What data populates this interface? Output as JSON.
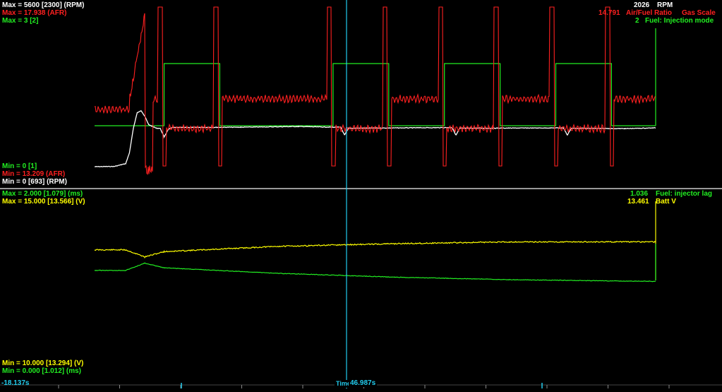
{
  "top_panel": {
    "labels_left_top": [
      {
        "text": "Max = 5600 [2300] (RPM)",
        "color": "#ffffff"
      },
      {
        "text": "Max = 17.938 (AFR)",
        "color": "#ff2020"
      },
      {
        "text": "Max = 3 [2]",
        "color": "#22ee22"
      }
    ],
    "labels_left_bottom": [
      {
        "text": "Min = 0 [1]",
        "color": "#22ee22"
      },
      {
        "text": "Min = 13.209 (AFR)",
        "color": "#ff2020"
      },
      {
        "text": "Min = 0 [693] (RPM)",
        "color": "#ffffff"
      }
    ],
    "readout_rpm": {
      "value": "2026",
      "unit": "RPM"
    },
    "readout_afr": {
      "value": "14.791",
      "name": "Air/Fuel Ratio",
      "extra": "Gas Scale"
    },
    "readout_injmode": {
      "value": "2",
      "name": "Fuel: Injection mode"
    }
  },
  "bottom_panel": {
    "labels_left_top": [
      {
        "text": "Max = 2.000 [1.079] (ms)",
        "color": "#22ee22"
      },
      {
        "text": "Max = 15.000 [13.566] (V)",
        "color": "#ffff00"
      }
    ],
    "labels_left_bottom": [
      {
        "text": "Min = 10.000 [13.294] (V)",
        "color": "#ffff00"
      },
      {
        "text": "Min = 0.000 [1.012] (ms)",
        "color": "#22ee22"
      }
    ],
    "readout_injlag": {
      "value": "1.036",
      "name": "Fuel: injector lag"
    },
    "readout_battv": {
      "value": "13.461",
      "name": "Batt V"
    }
  },
  "footer": {
    "start_time": "-18.137s",
    "cursor_label": "Time",
    "cursor_value": "46.987s"
  },
  "colors": {
    "rpm": "#ffffff",
    "afr": "#ff2020",
    "injection_mode": "#22ee22",
    "injector_lag": "#22ee22",
    "batt_v": "#ffff00",
    "cursor": "#22ccee",
    "divider": "#cccccc"
  },
  "chart_data": [
    {
      "type": "line",
      "x_range": [
        -18.137,
        103
      ],
      "series": [
        {
          "name": "RPM",
          "unit": "RPM",
          "ylim": [
            0,
            5600
          ],
          "color": "#ffffff",
          "points": [
            [
              -18.1,
              693
            ],
            [
              -13,
              700
            ],
            [
              -10,
              780
            ],
            [
              -9,
              1100
            ],
            [
              -8,
              1800
            ],
            [
              -7,
              2250
            ],
            [
              -6,
              2300
            ],
            [
              -5,
              2150
            ],
            [
              -4,
              1900
            ],
            [
              -3,
              1850
            ],
            [
              -2,
              1800
            ],
            [
              -1,
              1800
            ],
            [
              0,
              1550
            ],
            [
              1,
              1750
            ],
            [
              2,
              1820
            ],
            [
              20,
              1830
            ],
            [
              35,
              1850
            ],
            [
              44,
              1830
            ],
            [
              46,
              1830
            ],
            [
              47,
              1600
            ],
            [
              48,
              1800
            ],
            [
              75,
              1820
            ],
            [
              76,
              1600
            ],
            [
              77,
              1800
            ],
            [
              104,
              1810
            ],
            [
              105,
              1600
            ],
            [
              106,
              1800
            ],
            [
              120,
              1790
            ],
            [
              128,
              1810
            ]
          ]
        },
        {
          "name": "Air/Fuel Ratio",
          "unit": "AFR",
          "ylim": [
            13.209,
            17.938
          ],
          "color": "#ff2020"
        },
        {
          "name": "Fuel: Injection mode",
          "ylim": [
            0,
            3
          ],
          "color": "#22ee22",
          "points": [
            [
              -18.1,
              1
            ],
            [
              0,
              1
            ],
            [
              0,
              2
            ],
            [
              14.5,
              2
            ],
            [
              14.5,
              1
            ],
            [
              44,
              1
            ],
            [
              44,
              2
            ],
            [
              58.5,
              2
            ],
            [
              58.5,
              1
            ],
            [
              73,
              1
            ],
            [
              73,
              2
            ],
            [
              87.5,
              2
            ],
            [
              87.5,
              1
            ],
            [
              102,
              1
            ],
            [
              102,
              2
            ],
            [
              116.5,
              2
            ],
            [
              116.5,
              1
            ],
            [
              128,
              1
            ]
          ]
        }
      ]
    },
    {
      "type": "line",
      "x_range": [
        -18.137,
        103
      ],
      "series": [
        {
          "name": "Fuel: injector lag",
          "unit": "ms",
          "ylim": [
            0,
            2
          ],
          "color": "#22ee22",
          "points": [
            [
              -18.1,
              1.062
            ],
            [
              -10,
              1.062
            ],
            [
              -5,
              1.079
            ],
            [
              0,
              1.068
            ],
            [
              30,
              1.055
            ],
            [
              60,
              1.046
            ],
            [
              90,
              1.04
            ],
            [
              128,
              1.036
            ]
          ]
        },
        {
          "name": "Batt V",
          "unit": "V",
          "ylim": [
            10,
            15
          ],
          "color": "#ffff00",
          "points": [
            [
              -18.1,
              13.37
            ],
            [
              -10,
              13.37
            ],
            [
              -5,
              13.29
            ],
            [
              0,
              13.35
            ],
            [
              30,
              13.41
            ],
            [
              60,
              13.44
            ],
            [
              90,
              13.46
            ],
            [
              128,
              13.461
            ]
          ]
        }
      ]
    }
  ]
}
